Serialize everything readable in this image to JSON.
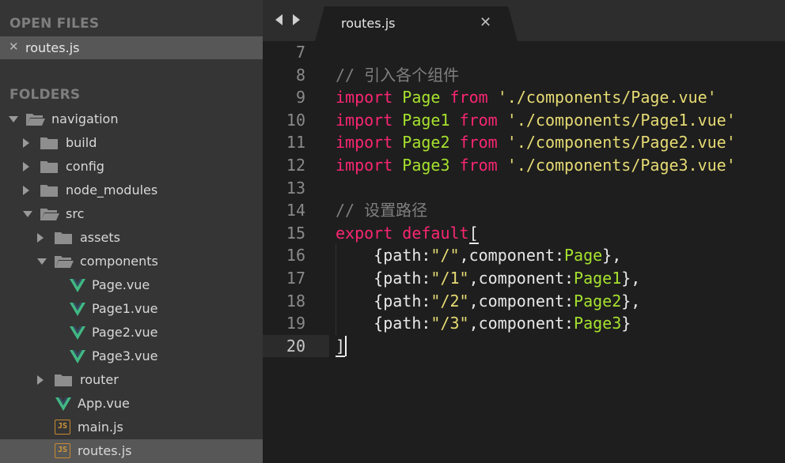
{
  "sidebar": {
    "open_files_title": "OPEN FILES",
    "open_files": [
      {
        "close_glyph": "✕",
        "label": "routes.js"
      }
    ],
    "folders_title": "FOLDERS",
    "tree": [
      {
        "label": "navigation",
        "depth": 0,
        "type": "folder",
        "expanded": true
      },
      {
        "label": "build",
        "depth": 1,
        "type": "folder",
        "expanded": false
      },
      {
        "label": "config",
        "depth": 1,
        "type": "folder",
        "expanded": false
      },
      {
        "label": "node_modules",
        "depth": 1,
        "type": "folder",
        "expanded": false
      },
      {
        "label": "src",
        "depth": 1,
        "type": "folder",
        "expanded": true
      },
      {
        "label": "assets",
        "depth": 2,
        "type": "folder",
        "expanded": false
      },
      {
        "label": "components",
        "depth": 2,
        "type": "folder",
        "expanded": true
      },
      {
        "label": "Page.vue",
        "depth": 3,
        "type": "vue"
      },
      {
        "label": "Page1.vue",
        "depth": 3,
        "type": "vue"
      },
      {
        "label": "Page2.vue",
        "depth": 3,
        "type": "vue"
      },
      {
        "label": "Page3.vue",
        "depth": 3,
        "type": "vue"
      },
      {
        "label": "router",
        "depth": 2,
        "type": "folder",
        "expanded": false
      },
      {
        "label": "App.vue",
        "depth": 2,
        "type": "vue"
      },
      {
        "label": "main.js",
        "depth": 2,
        "type": "js"
      },
      {
        "label": "routes.js",
        "depth": 2,
        "type": "js",
        "selected": true
      }
    ]
  },
  "tabbar": {
    "back_icon": "chevron-left-icon",
    "forward_icon": "chevron-right-icon",
    "tabs": [
      {
        "label": "routes.js",
        "close_glyph": "✕",
        "active": true
      }
    ]
  },
  "editor": {
    "active_line": 20,
    "lines": [
      {
        "num": "7",
        "tokens": []
      },
      {
        "num": "8",
        "tokens": [
          {
            "t": "comment",
            "v": "// 引入各个组件"
          }
        ]
      },
      {
        "num": "9",
        "tokens": [
          {
            "t": "kw",
            "v": "import"
          },
          {
            "t": "plain",
            "v": " "
          },
          {
            "t": "name",
            "v": "Page"
          },
          {
            "t": "plain",
            "v": " "
          },
          {
            "t": "kw",
            "v": "from"
          },
          {
            "t": "plain",
            "v": " "
          },
          {
            "t": "str",
            "v": "'./components/Page.vue'"
          }
        ]
      },
      {
        "num": "10",
        "tokens": [
          {
            "t": "kw",
            "v": "import"
          },
          {
            "t": "plain",
            "v": " "
          },
          {
            "t": "name",
            "v": "Page1"
          },
          {
            "t": "plain",
            "v": " "
          },
          {
            "t": "kw",
            "v": "from"
          },
          {
            "t": "plain",
            "v": " "
          },
          {
            "t": "str",
            "v": "'./components/Page1.vue'"
          }
        ]
      },
      {
        "num": "11",
        "tokens": [
          {
            "t": "kw",
            "v": "import"
          },
          {
            "t": "plain",
            "v": " "
          },
          {
            "t": "name",
            "v": "Page2"
          },
          {
            "t": "plain",
            "v": " "
          },
          {
            "t": "kw",
            "v": "from"
          },
          {
            "t": "plain",
            "v": " "
          },
          {
            "t": "str",
            "v": "'./components/Page2.vue'"
          }
        ]
      },
      {
        "num": "12",
        "tokens": [
          {
            "t": "kw",
            "v": "import"
          },
          {
            "t": "plain",
            "v": " "
          },
          {
            "t": "name",
            "v": "Page3"
          },
          {
            "t": "plain",
            "v": " "
          },
          {
            "t": "kw",
            "v": "from"
          },
          {
            "t": "plain",
            "v": " "
          },
          {
            "t": "str",
            "v": "'./components/Page3.vue'"
          }
        ]
      },
      {
        "num": "13",
        "tokens": []
      },
      {
        "num": "14",
        "tokens": [
          {
            "t": "comment",
            "v": "// 设置路径"
          }
        ]
      },
      {
        "num": "15",
        "tokens": [
          {
            "t": "kw",
            "v": "export"
          },
          {
            "t": "plain",
            "v": " "
          },
          {
            "t": "kw",
            "v": "default"
          },
          {
            "t": "bracket",
            "v": "["
          }
        ]
      },
      {
        "num": "16",
        "tokens": [
          {
            "t": "plain",
            "v": "    {path:"
          },
          {
            "t": "str",
            "v": "\"/\""
          },
          {
            "t": "plain",
            "v": ",component:"
          },
          {
            "t": "name",
            "v": "Page"
          },
          {
            "t": "plain",
            "v": "},"
          }
        ]
      },
      {
        "num": "17",
        "tokens": [
          {
            "t": "plain",
            "v": "    {path:"
          },
          {
            "t": "str",
            "v": "\"/1\""
          },
          {
            "t": "plain",
            "v": ",component:"
          },
          {
            "t": "name",
            "v": "Page1"
          },
          {
            "t": "plain",
            "v": "},"
          }
        ]
      },
      {
        "num": "18",
        "tokens": [
          {
            "t": "plain",
            "v": "    {path:"
          },
          {
            "t": "str",
            "v": "\"/2\""
          },
          {
            "t": "plain",
            "v": ",component:"
          },
          {
            "t": "name",
            "v": "Page2"
          },
          {
            "t": "plain",
            "v": "},"
          }
        ]
      },
      {
        "num": "19",
        "tokens": [
          {
            "t": "plain",
            "v": "    {path:"
          },
          {
            "t": "str",
            "v": "\"/3\""
          },
          {
            "t": "plain",
            "v": ",component:"
          },
          {
            "t": "name",
            "v": "Page3"
          },
          {
            "t": "plain",
            "v": "}"
          }
        ]
      },
      {
        "num": "20",
        "tokens": [
          {
            "t": "bracket",
            "v": "]"
          }
        ]
      }
    ]
  },
  "colors": {
    "keyword": "#f92672",
    "name": "#a6e22e",
    "string": "#e6db74",
    "comment": "#7f7f7f",
    "vue_icon": "#41b883",
    "js_icon": "#d49a3a"
  }
}
